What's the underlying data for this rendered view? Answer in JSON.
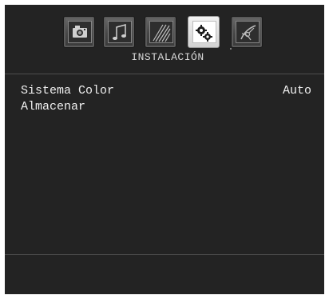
{
  "header": {
    "title": "INSTALACIÓN",
    "icons": [
      {
        "name": "photo-icon",
        "active": false
      },
      {
        "name": "music-icon",
        "active": false
      },
      {
        "name": "movie-icon",
        "active": false
      },
      {
        "name": "settings-icon",
        "active": true
      },
      {
        "name": "satellite-icon",
        "active": false
      }
    ]
  },
  "menu": {
    "items": [
      {
        "label": "Sistema Color",
        "value": "Auto"
      },
      {
        "label": "Almacenar",
        "value": ""
      }
    ]
  },
  "colors": {
    "background": "#232323",
    "text": "#f0f0f0",
    "divider": "#4e4e4e"
  }
}
